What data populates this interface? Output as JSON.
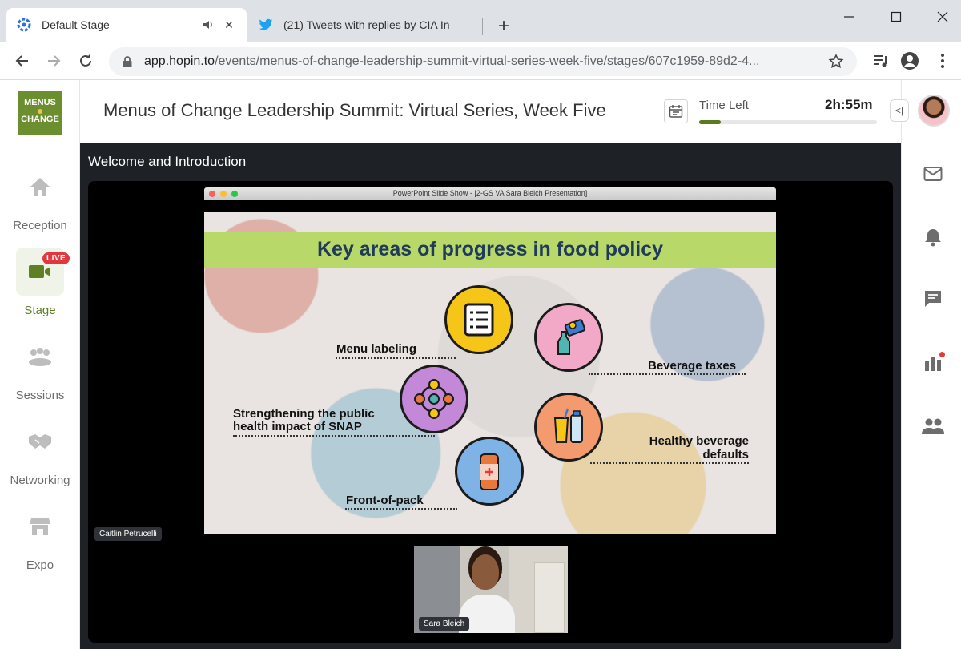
{
  "browser": {
    "tabs": [
      {
        "title": "Default Stage",
        "active": true
      },
      {
        "title": "(21) Tweets with replies by CIA In",
        "active": false
      }
    ],
    "address": {
      "host": "app.hopin.to",
      "path": "/events/menus-of-change-leadership-summit-virtual-series-week-five/stages/607c1959-89d2-4..."
    }
  },
  "logo": {
    "line1": "MENUS",
    "line2": "CHANGE"
  },
  "nav": {
    "items": [
      {
        "label": "Reception",
        "icon": "home-icon"
      },
      {
        "label": "Stage",
        "icon": "camera-icon",
        "badge": "LIVE",
        "active": true
      },
      {
        "label": "Sessions",
        "icon": "group-icon"
      },
      {
        "label": "Networking",
        "icon": "handshake-icon"
      },
      {
        "label": "Expo",
        "icon": "booth-icon"
      }
    ]
  },
  "header": {
    "title": "Menus of Change Leadership Summit: Virtual Series, Week Five",
    "time_left_label": "Time Left",
    "time_left_value": "2h:55m",
    "time_progress": 0.12
  },
  "stage": {
    "segment_title": "Welcome and Introduction",
    "presenter_tag": "Caitlin Petrucelli",
    "camera_tag": "Sara Bleich",
    "ppt_window_title": "PowerPoint Slide Show - [2-GS VA Sara Bleich Presentation]",
    "slide": {
      "title": "Key areas of progress in food policy",
      "items": {
        "menu": "Menu labeling",
        "beverage_taxes": "Beverage taxes",
        "snap_line1": "Strengthening the public",
        "snap_line2": "health impact of SNAP",
        "defaults_line1": "Healthy beverage",
        "defaults_line2": "defaults",
        "front_of_pack": "Front-of-pack"
      }
    }
  },
  "colors": {
    "brand_green": "#6b8e2f",
    "live_red": "#e0383e",
    "slide_band": "#b9d86a",
    "slide_title": "#1f3a5a"
  }
}
